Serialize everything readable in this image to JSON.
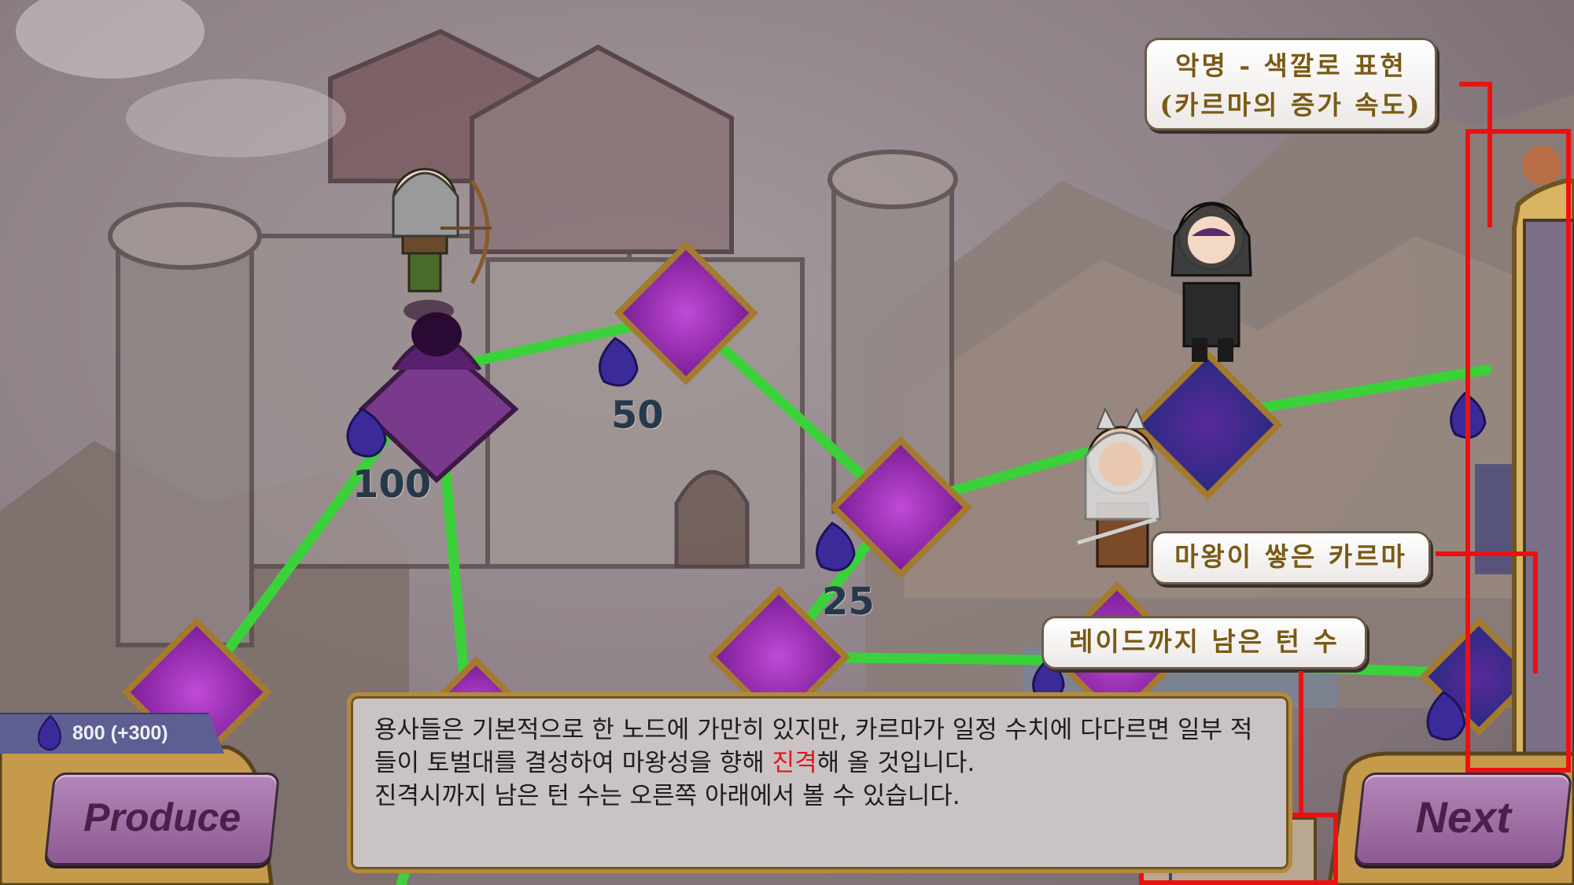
{
  "resources": {
    "karma_display": "800 (+300)"
  },
  "node_costs": [
    "100",
    "50",
    "25",
    "50"
  ],
  "annotations": {
    "infamy": [
      "악명 - 색깔로 표현",
      "(카르마의 증가 속도)"
    ],
    "demon_karma": "마왕이 쌓은 카르마",
    "turns_left": "레이드까지 남은 턴 수"
  },
  "buttons": {
    "produce": "Produce",
    "next": "Next"
  },
  "dialog": {
    "line1": "용사들은 기본적으로 한 노드에 가만히 있지만, 카르마가 일정 수치에 다다르면 일부 적들이 토벌대를 결성하여 마왕성을 향해 ",
    "highlight": "진격",
    "line2": "해 올 것입니다.",
    "line3": "진격시까지 남은 턴 수는 오른쪽 아래에서 볼 수 있습니다."
  },
  "colors": {
    "path": "#3ad13a",
    "node_purple": "#8a1fa6",
    "node_blue": "#2a2a8c",
    "node_border": "#a37a2e",
    "annotation_red": "#ee1010",
    "karma_drop": "#3b2a9a"
  }
}
